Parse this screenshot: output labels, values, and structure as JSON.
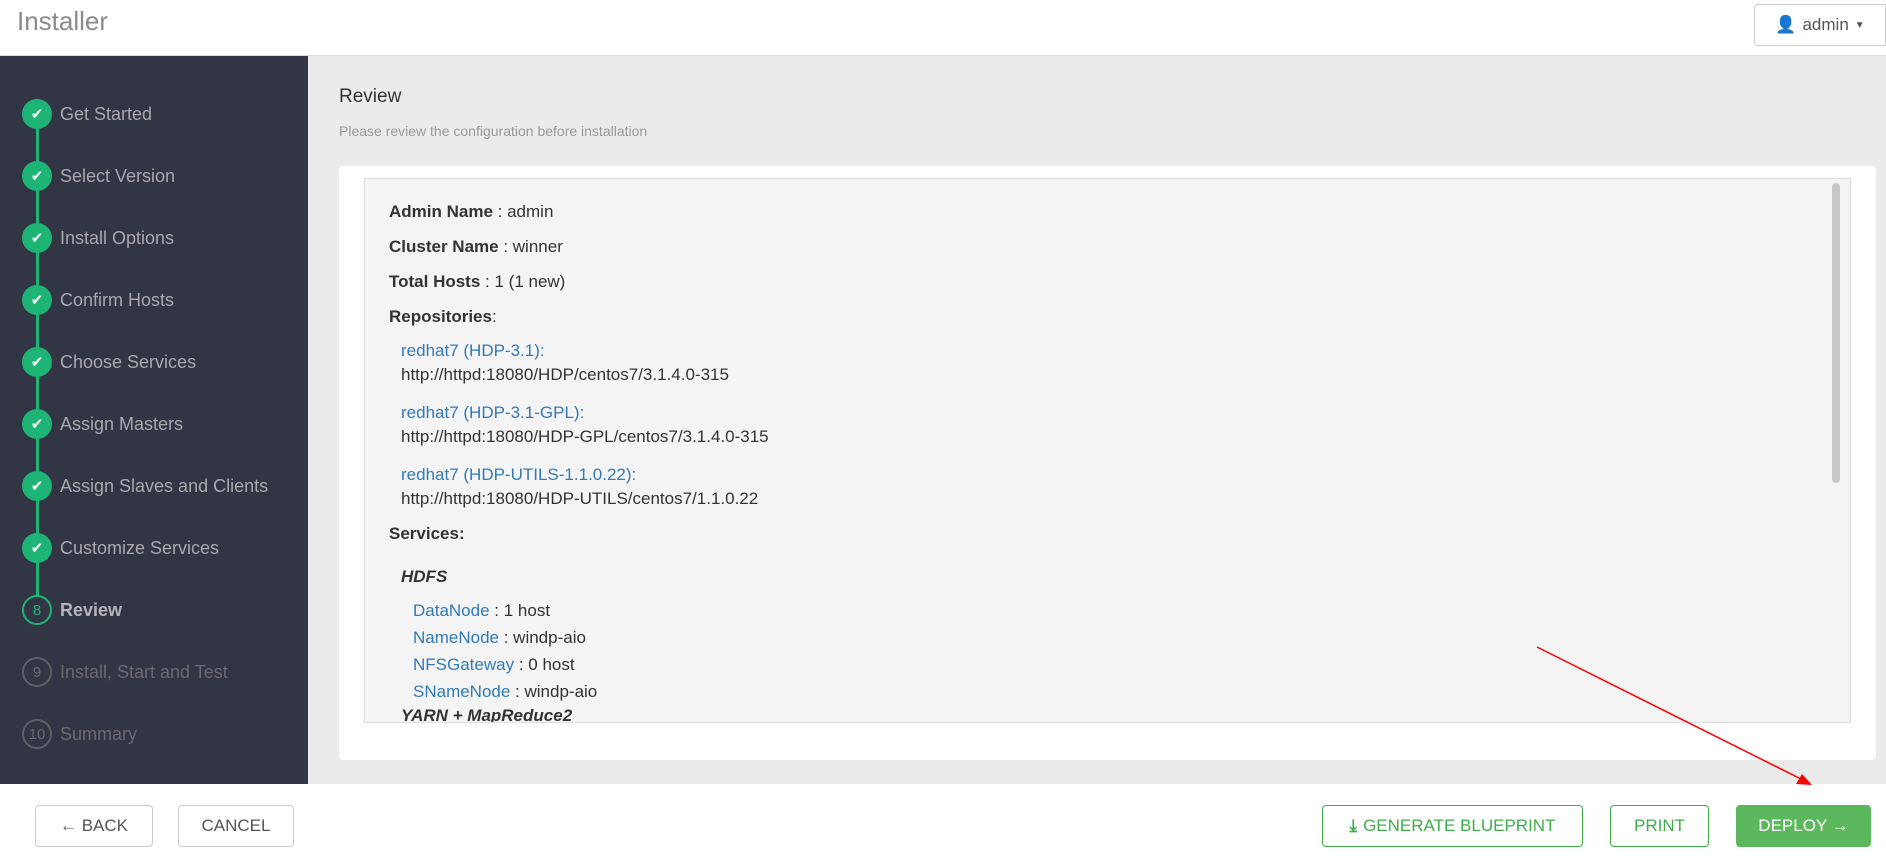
{
  "header": {
    "title": "Installer",
    "user": "admin"
  },
  "steps": [
    {
      "label": "Get Started",
      "state": "done"
    },
    {
      "label": "Select Version",
      "state": "done"
    },
    {
      "label": "Install Options",
      "state": "done"
    },
    {
      "label": "Confirm Hosts",
      "state": "done"
    },
    {
      "label": "Choose Services",
      "state": "done"
    },
    {
      "label": "Assign Masters",
      "state": "done"
    },
    {
      "label": "Assign Slaves and Clients",
      "state": "done"
    },
    {
      "label": "Customize Services",
      "state": "done"
    },
    {
      "label": "Review",
      "state": "current",
      "num": "8"
    },
    {
      "label": "Install, Start and Test",
      "state": "todo",
      "num": "9"
    },
    {
      "label": "Summary",
      "state": "todo",
      "num": "10"
    }
  ],
  "main": {
    "title": "Review",
    "subtitle": "Please review the configuration before installation",
    "admin_label": "Admin Name",
    "admin_value": " : admin",
    "cluster_label": "Cluster Name",
    "cluster_value": " : winner",
    "hosts_label": "Total Hosts",
    "hosts_value": " : 1 (1 new)",
    "repos_label": "Repositories",
    "repos": [
      {
        "name": "redhat7 (HDP-3.1):",
        "url": "http://httpd:18080/HDP/centos7/3.1.4.0-315"
      },
      {
        "name": "redhat7 (HDP-3.1-GPL):",
        "url": "http://httpd:18080/HDP-GPL/centos7/3.1.4.0-315"
      },
      {
        "name": "redhat7 (HDP-UTILS-1.1.0.22):",
        "url": "http://httpd:18080/HDP-UTILS/centos7/1.1.0.22"
      }
    ],
    "services_label": "Services:",
    "services": [
      {
        "name": "HDFS",
        "components": [
          {
            "name": "DataNode",
            "value": " : 1 host"
          },
          {
            "name": "NameNode",
            "value": " : windp-aio"
          },
          {
            "name": "NFSGateway",
            "value": " : 0 host"
          },
          {
            "name": "SNameNode",
            "value": " : windp-aio"
          }
        ]
      },
      {
        "name": "YARN + MapReduce2",
        "components": []
      }
    ]
  },
  "footer": {
    "back": "← BACK",
    "cancel": "CANCEL",
    "blueprint": "GENERATE BLUEPRINT",
    "print": "PRINT",
    "deploy": "DEPLOY →"
  },
  "colors": {
    "accent": "#1eb475",
    "deploy": "#5cb85c",
    "link": "#337ab7",
    "annotation_arrow": "#ff0000"
  }
}
